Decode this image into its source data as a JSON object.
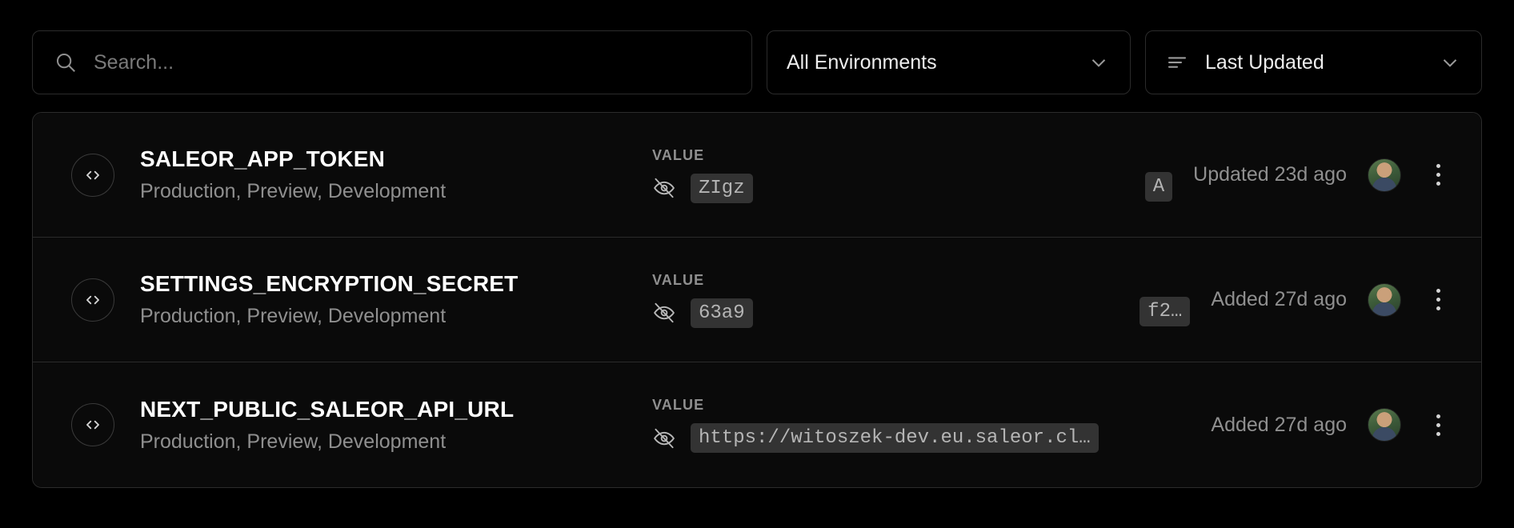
{
  "toolbar": {
    "search": {
      "placeholder": "Search...",
      "value": "",
      "icon": "search-icon"
    },
    "environment_filter": {
      "label": "All Environments",
      "icon": "chevron-down-icon"
    },
    "sort_filter": {
      "label": "Last Updated",
      "leading_icon": "sort-lines-icon",
      "icon": "chevron-down-icon"
    }
  },
  "value_column_header": "VALUE",
  "rows": [
    {
      "icon": "code-brackets-icon",
      "name": "SALEOR_APP_TOKEN",
      "environments": "Production, Preview, Development",
      "value_label": "VALUE",
      "visibility_icon": "eye-off-icon",
      "value_masked": "ZIgz",
      "value_tail": "A",
      "meta": "Updated 23d ago",
      "avatar": "user-avatar",
      "menu_icon": "kebab-menu-icon"
    },
    {
      "icon": "code-brackets-icon",
      "name": "SETTINGS_ENCRYPTION_SECRET",
      "environments": "Production, Preview, Development",
      "value_label": "VALUE",
      "visibility_icon": "eye-off-icon",
      "value_masked": "63a9",
      "value_tail": "f2…",
      "meta": "Added 27d ago",
      "avatar": "user-avatar",
      "menu_icon": "kebab-menu-icon"
    },
    {
      "icon": "code-brackets-icon",
      "name": "NEXT_PUBLIC_SALEOR_API_URL",
      "environments": "Production, Preview, Development",
      "value_label": "VALUE",
      "visibility_icon": "eye-off-icon",
      "value_masked": "https://witoszek-dev.eu.saleor.cl…",
      "value_tail": "",
      "meta": "Added 27d ago",
      "avatar": "user-avatar",
      "menu_icon": "kebab-menu-icon"
    }
  ],
  "colors": {
    "background": "#000000",
    "surface": "#0a0a0a",
    "border": "#2b2b2b",
    "text_primary": "#ffffff",
    "text_muted": "#8f8f8f",
    "chip_bg": "#333333"
  }
}
